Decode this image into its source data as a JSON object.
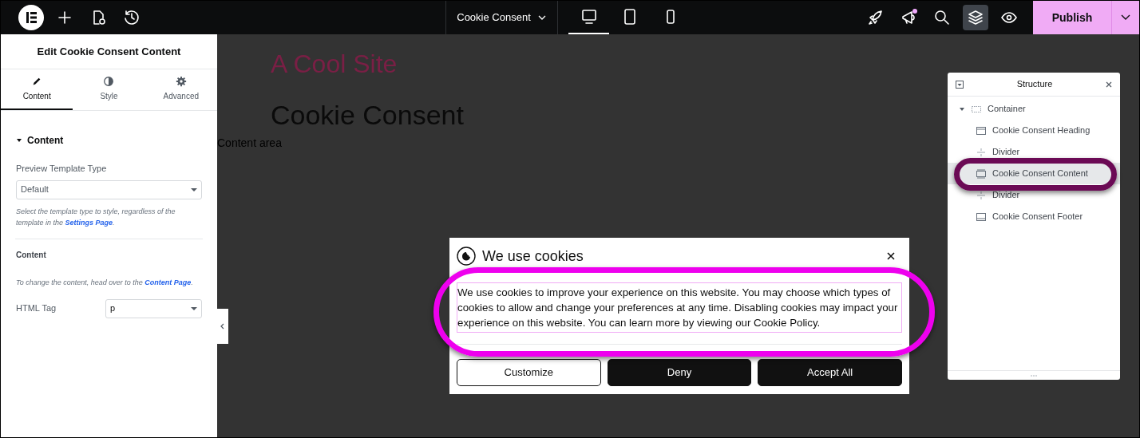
{
  "top_bar": {
    "left_tools": [
      {
        "kind": "logo"
      },
      {
        "kind": "add"
      },
      {
        "kind": "page-settings"
      },
      {
        "kind": "history"
      }
    ],
    "document": {
      "title": "Cookie Consent"
    },
    "devices": [
      {
        "kind": "desktop",
        "selected": true
      },
      {
        "kind": "tablet",
        "selected": false
      },
      {
        "kind": "mobile",
        "selected": false
      }
    ],
    "right_tools": [
      {
        "kind": "rocket",
        "selected": false,
        "notification": false
      },
      {
        "kind": "megaphone",
        "selected": false,
        "notification": true
      },
      {
        "kind": "search",
        "selected": false,
        "notification": false
      },
      {
        "kind": "layers",
        "selected": true,
        "notification": false
      },
      {
        "kind": "preview",
        "selected": false,
        "notification": false
      }
    ],
    "publish": {
      "label": "Publish"
    }
  },
  "panel": {
    "title": "Edit Cookie Consent Content",
    "tabs": [
      {
        "label": "Content",
        "kind": "pencil",
        "selected": true
      },
      {
        "label": "Style",
        "kind": "contrast",
        "selected": false
      },
      {
        "label": "Advanced",
        "kind": "gear",
        "selected": false
      }
    ],
    "section": {
      "title": "Content",
      "expanded": true
    },
    "template_field": {
      "label": "Preview Template Type",
      "value": "Default"
    },
    "template_help": {
      "text": "Select the template type to style, regardless of the template in the ",
      "link": "Settings Page",
      "after": "."
    },
    "content_heading": "Content",
    "content_help": {
      "text": "To change the content, head over to the ",
      "link": "Content Page",
      "after": "."
    },
    "tag_field": {
      "label": "HTML Tag",
      "value": "p"
    }
  },
  "canvas": {
    "site_title": "A Cool Site",
    "heading": "Cookie Consent",
    "content_area": "Content area"
  },
  "popup": {
    "title": "We use cookies",
    "body": "We use cookies to improve your experience on this website. You may choose which types of cookies to allow and change your preferences at any time. Disabling cookies may impact your experience on this website. You can learn more by viewing our Cookie Policy.",
    "buttons": [
      {
        "label": "Customize",
        "kind": "outline"
      },
      {
        "label": "Deny",
        "kind": "solid"
      },
      {
        "label": "Accept All",
        "kind": "solid"
      }
    ]
  },
  "structure": {
    "title": "Structure",
    "tree": [
      {
        "label": "Container",
        "kind": "container",
        "expanded": true,
        "selected": false,
        "children": [
          {
            "label": "Cookie Consent Heading",
            "kind": "heading",
            "selected": false
          },
          {
            "label": "Divider",
            "kind": "divider",
            "selected": false
          },
          {
            "label": "Cookie Consent Content",
            "kind": "content",
            "selected": true
          },
          {
            "label": "Divider",
            "kind": "divider",
            "selected": false
          },
          {
            "label": "Cookie Consent Footer",
            "kind": "footer",
            "selected": false
          }
        ]
      }
    ]
  },
  "annotations": [
    {
      "kind": "ellipse",
      "color": "#ee00ee"
    },
    {
      "kind": "ellipse",
      "color": "#6b0a55"
    }
  ]
}
